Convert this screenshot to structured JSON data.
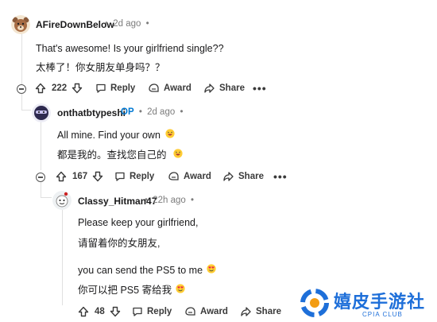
{
  "comments": [
    {
      "username": "AFireDownBelow",
      "time": "2d ago",
      "lines": [
        "That's awesome! Is your girlfriend single??",
        "太棒了！你女朋友单身吗？？"
      ],
      "votes": "222",
      "actions": {
        "reply": "Reply",
        "award": "Award",
        "share": "Share"
      }
    },
    {
      "username": "onthatbtypeshi",
      "op_badge": "OP",
      "time": "2d ago",
      "lines": [
        "All mine. Find your own",
        "都是我的。查找您自己的"
      ],
      "votes": "167",
      "actions": {
        "reply": "Reply",
        "award": "Award",
        "share": "Share"
      }
    },
    {
      "username": "Classy_Hitman47",
      "time": "22h ago",
      "lines": [
        "Please keep your girlfriend,",
        "请留着你的女朋友,",
        "you can send the PS5 to me",
        "你可以把 PS5 寄给我"
      ],
      "votes": "48",
      "actions": {
        "reply": "Reply",
        "award": "Award",
        "share": "Share"
      }
    }
  ],
  "separator": "•",
  "more": "•••",
  "watermark": {
    "title": "嬉皮手游社",
    "subtitle": "CPIA CLUB"
  },
  "icons": [
    "avatar-bear-icon",
    "avatar-ninja-icon",
    "avatar-robot-icon",
    "collapse-icon",
    "upvote-icon",
    "downvote-icon",
    "reply-icon",
    "award-icon",
    "share-icon",
    "more-icon",
    "laughing-emoji",
    "heart-eyes-emoji"
  ],
  "colors": {
    "op": "#0079d3",
    "meta": "#7c7c7c",
    "thread_line": "#e0e0e0",
    "watermark_blue": "#1e6fd9",
    "watermark_orange": "#f39c12"
  }
}
